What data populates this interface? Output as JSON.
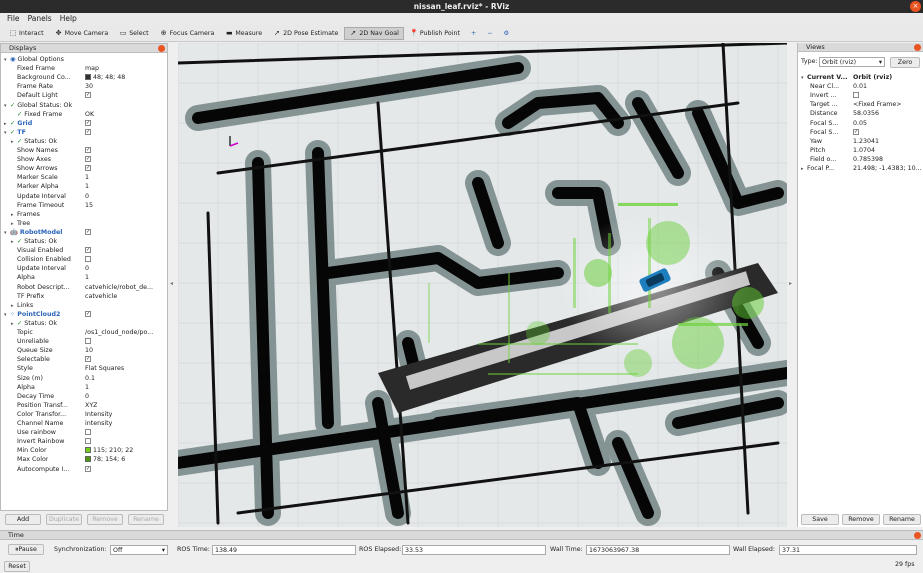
{
  "window": {
    "title": "nissan_leaf.rviz* - RViz",
    "close_glyph": "×"
  },
  "menu": [
    "File",
    "Panels",
    "Help"
  ],
  "toolbar": [
    {
      "label": "Interact",
      "icon": "interact-icon",
      "glyph": "⬚"
    },
    {
      "label": "Move Camera",
      "icon": "move-camera-icon",
      "glyph": "✥"
    },
    {
      "label": "Select",
      "icon": "select-icon",
      "glyph": "▭"
    },
    {
      "label": "Focus Camera",
      "icon": "focus-camera-icon",
      "glyph": "⊕"
    },
    {
      "label": "Measure",
      "icon": "measure-icon",
      "glyph": "▬"
    },
    {
      "label": "2D Pose Estimate",
      "icon": "pose-estimate-icon",
      "glyph": "➚"
    },
    {
      "label": "2D Nav Goal",
      "icon": "nav-goal-icon",
      "glyph": "➚",
      "active": true
    },
    {
      "label": "Publish Point",
      "icon": "publish-point-icon",
      "glyph": "📍"
    }
  ],
  "toolbar_extra": {
    "plus": "+",
    "minus": "−",
    "gear": "⚙"
  },
  "displays": {
    "title": "Displays",
    "rows": [
      {
        "d": 0,
        "tri": "▾",
        "icon": "◉",
        "k": "Global Options"
      },
      {
        "d": 1,
        "k": "Fixed Frame",
        "v": "map"
      },
      {
        "d": 1,
        "k": "Background Co...",
        "sw": "#303030",
        "v": "48; 48; 48"
      },
      {
        "d": 1,
        "k": "Frame Rate",
        "v": "30"
      },
      {
        "d": 1,
        "k": "Default Light",
        "cb": true
      },
      {
        "d": 0,
        "tri": "▾",
        "ok": true,
        "k": "Global Status: Ok"
      },
      {
        "d": 1,
        "ok": true,
        "k": "Fixed Frame",
        "v": "OK"
      },
      {
        "d": 0,
        "tri": "▸",
        "ok": true,
        "k": "Grid",
        "blue": true,
        "cb": true
      },
      {
        "d": 0,
        "tri": "▾",
        "ok": true,
        "k": "TF",
        "blue": true,
        "cb": true
      },
      {
        "d": 1,
        "tri": "▸",
        "ok": true,
        "k": "Status: Ok"
      },
      {
        "d": 1,
        "k": "Show Names",
        "cb": true
      },
      {
        "d": 1,
        "k": "Show Axes",
        "cb": true
      },
      {
        "d": 1,
        "k": "Show Arrows",
        "cb": true
      },
      {
        "d": 1,
        "k": "Marker Scale",
        "v": "1"
      },
      {
        "d": 1,
        "k": "Marker Alpha",
        "v": "1"
      },
      {
        "d": 1,
        "k": "Update Interval",
        "v": "0"
      },
      {
        "d": 1,
        "k": "Frame Timeout",
        "v": "15"
      },
      {
        "d": 1,
        "tri": "▸",
        "k": "Frames"
      },
      {
        "d": 1,
        "tri": "▸",
        "k": "Tree"
      },
      {
        "d": 0,
        "tri": "▾",
        "icon": "🤖",
        "k": "RobotModel",
        "blue": true,
        "cb": true
      },
      {
        "d": 1,
        "tri": "▸",
        "ok": true,
        "k": "Status: Ok"
      },
      {
        "d": 1,
        "k": "Visual Enabled",
        "cb": true
      },
      {
        "d": 1,
        "k": "Collision Enabled",
        "cb": false
      },
      {
        "d": 1,
        "k": "Update Interval",
        "v": "0"
      },
      {
        "d": 1,
        "k": "Alpha",
        "v": "1"
      },
      {
        "d": 1,
        "k": "Robot Descript...",
        "v": "catvehicle/robot_de..."
      },
      {
        "d": 1,
        "k": "TF Prefix",
        "v": "catvehicle"
      },
      {
        "d": 1,
        "tri": "▸",
        "k": "Links"
      },
      {
        "d": 0,
        "tri": "▾",
        "icon": "⁘",
        "k": "PointCloud2",
        "blue": true,
        "cb": true
      },
      {
        "d": 1,
        "tri": "▸",
        "ok": true,
        "k": "Status: Ok"
      },
      {
        "d": 1,
        "k": "Topic",
        "v": "/os1_cloud_node/po..."
      },
      {
        "d": 1,
        "k": "Unreliable",
        "cb": false
      },
      {
        "d": 1,
        "k": "Queue Size",
        "v": "10"
      },
      {
        "d": 1,
        "k": "Selectable",
        "cb": true
      },
      {
        "d": 1,
        "k": "Style",
        "v": "Flat Squares"
      },
      {
        "d": 1,
        "k": "Size (m)",
        "v": "0.1"
      },
      {
        "d": 1,
        "k": "Alpha",
        "v": "1"
      },
      {
        "d": 1,
        "k": "Decay Time",
        "v": "0"
      },
      {
        "d": 1,
        "k": "Position Transf...",
        "v": "XYZ"
      },
      {
        "d": 1,
        "k": "Color Transfor...",
        "v": "Intensity"
      },
      {
        "d": 1,
        "k": "Channel Name",
        "v": "intensity"
      },
      {
        "d": 1,
        "k": "Use rainbow",
        "cb": false
      },
      {
        "d": 1,
        "k": "Invert Rainbow",
        "cb": false
      },
      {
        "d": 1,
        "k": "Min Color",
        "sw": "#73d216",
        "v": "115; 210; 22"
      },
      {
        "d": 1,
        "k": "Max Color",
        "sw": "#4e9a06",
        "v": "78; 154; 6"
      },
      {
        "d": 1,
        "k": "Autocompute I...",
        "cb": true
      }
    ],
    "buttons": [
      {
        "label": "Add",
        "enabled": true
      },
      {
        "label": "Duplicate",
        "enabled": false
      },
      {
        "label": "Remove",
        "enabled": false
      },
      {
        "label": "Rename",
        "enabled": false
      }
    ]
  },
  "views": {
    "title": "Views",
    "type_label": "Type:",
    "type_value": "Orbit (rviz)",
    "zero": "Zero",
    "rows": [
      {
        "tri": "▾",
        "k": "Current V...",
        "v": "Orbit (rviz)",
        "bold": true
      },
      {
        "k": "Near Cl...",
        "v": "0.01"
      },
      {
        "k": "Invert ...",
        "cb": false
      },
      {
        "k": "Target ...",
        "v": "<Fixed Frame>"
      },
      {
        "k": "Distance",
        "v": "58.0356"
      },
      {
        "k": "Focal S...",
        "v": "0.05"
      },
      {
        "k": "Focal S...",
        "cb": true
      },
      {
        "k": "Yaw",
        "v": "1.23041"
      },
      {
        "k": "Pitch",
        "v": "1.0704"
      },
      {
        "k": "Field o...",
        "v": "0.785398"
      },
      {
        "tri": "▸",
        "k": "Focal P...",
        "v": "21.498; -1.4383; 10..."
      }
    ],
    "buttons": [
      "Save",
      "Remove",
      "Rename"
    ]
  },
  "time": {
    "title": "Time",
    "pause": "Pause",
    "sync_label": "Synchronization:",
    "sync_value": "Off",
    "ros_time_label": "ROS Time:",
    "ros_time": "138.49",
    "ros_elapsed_label": "ROS Elapsed:",
    "ros_elapsed": "33.53",
    "wall_time_label": "Wall Time:",
    "wall_time": "1673063967.38",
    "wall_elapsed_label": "Wall Elapsed:",
    "wall_elapsed": "37.31",
    "reset": "Reset",
    "fps": "29 fps"
  }
}
